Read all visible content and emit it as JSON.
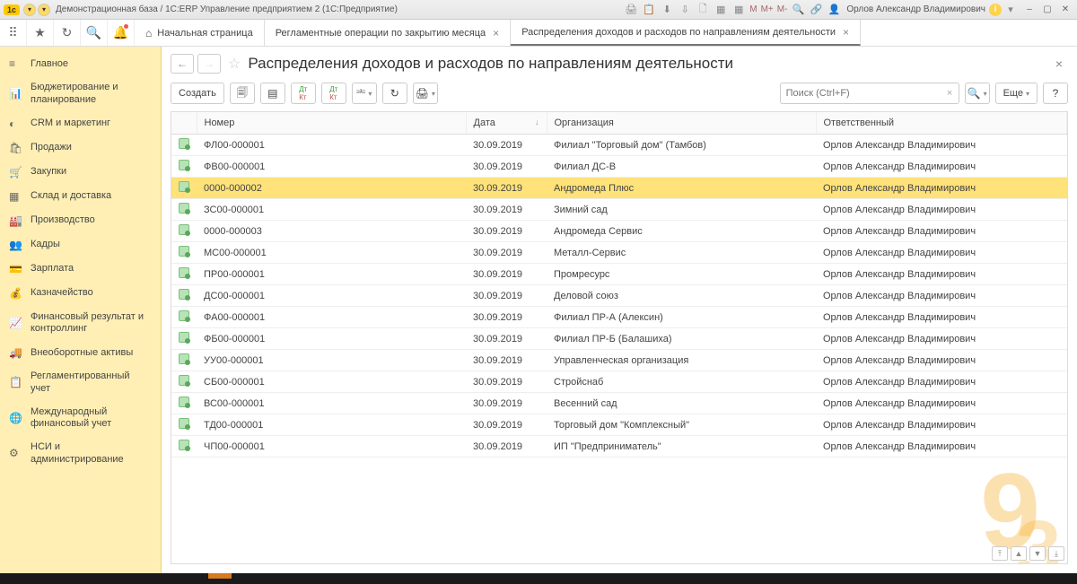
{
  "titlebar": {
    "logo": "1c",
    "title": "Демонстрационная база / 1С:ERP Управление предприятием 2  (1С:Предприятие)",
    "m1": "M",
    "m2": "M+",
    "m3": "M-",
    "user": "Орлов Александр Владимирович"
  },
  "tabs": {
    "home_label": "Начальная страница",
    "tab1": "Регламентные операции по закрытию месяца",
    "tab2": "Распределения доходов и расходов по направлениям деятельности"
  },
  "sidebar": {
    "items": [
      {
        "icon": "≡",
        "label": "Главное"
      },
      {
        "icon": "📊",
        "label": "Бюджетирование и планирование"
      },
      {
        "icon": "◐",
        "label": "CRM и маркетинг"
      },
      {
        "icon": "🛍",
        "label": "Продажи"
      },
      {
        "icon": "🛒",
        "label": "Закупки"
      },
      {
        "icon": "▦",
        "label": "Склад и доставка"
      },
      {
        "icon": "🏭",
        "label": "Производство"
      },
      {
        "icon": "👥",
        "label": "Кадры"
      },
      {
        "icon": "💳",
        "label": "Зарплата"
      },
      {
        "icon": "💰",
        "label": "Казначейство"
      },
      {
        "icon": "📈",
        "label": "Финансовый результат и контроллинг"
      },
      {
        "icon": "🚚",
        "label": "Внеоборотные активы"
      },
      {
        "icon": "📋",
        "label": "Регламентированный учет"
      },
      {
        "icon": "🌐",
        "label": "Международный финансовый учет"
      },
      {
        "icon": "⚙",
        "label": "НСИ и администрирование"
      }
    ]
  },
  "page": {
    "title": "Распределения доходов и расходов по направлениям деятельности",
    "create_label": "Создать",
    "more_label": "Еще",
    "search_placeholder": "Поиск (Ctrl+F)"
  },
  "table": {
    "cols": {
      "num": "Номер",
      "date": "Дата",
      "org": "Организация",
      "resp": "Ответственный"
    },
    "rows": [
      {
        "num": "ФЛ00-000001",
        "date": "30.09.2019",
        "org": "Филиал \"Торговый дом\" (Тамбов)",
        "resp": "Орлов Александр Владимирович",
        "sel": false
      },
      {
        "num": "ФВ00-000001",
        "date": "30.09.2019",
        "org": "Филиал ДС-В",
        "resp": "Орлов Александр Владимирович",
        "sel": false
      },
      {
        "num": "0000-000002",
        "date": "30.09.2019",
        "org": "Андромеда Плюс",
        "resp": "Орлов Александр Владимирович",
        "sel": true
      },
      {
        "num": "ЗС00-000001",
        "date": "30.09.2019",
        "org": "Зимний сад",
        "resp": "Орлов Александр Владимирович",
        "sel": false
      },
      {
        "num": "0000-000003",
        "date": "30.09.2019",
        "org": "Андромеда Сервис",
        "resp": "Орлов Александр Владимирович",
        "sel": false
      },
      {
        "num": "МС00-000001",
        "date": "30.09.2019",
        "org": "Металл-Сервис",
        "resp": "Орлов Александр Владимирович",
        "sel": false
      },
      {
        "num": "ПР00-000001",
        "date": "30.09.2019",
        "org": "Промресурс",
        "resp": "Орлов Александр Владимирович",
        "sel": false
      },
      {
        "num": "ДС00-000001",
        "date": "30.09.2019",
        "org": "Деловой союз",
        "resp": "Орлов Александр Владимирович",
        "sel": false
      },
      {
        "num": "ФА00-000001",
        "date": "30.09.2019",
        "org": "Филиал ПР-А (Алексин)",
        "resp": "Орлов Александр Владимирович",
        "sel": false
      },
      {
        "num": "ФБ00-000001",
        "date": "30.09.2019",
        "org": "Филиал ПР-Б (Балашиха)",
        "resp": "Орлов Александр Владимирович",
        "sel": false
      },
      {
        "num": "УУ00-000001",
        "date": "30.09.2019",
        "org": "Управленческая организация",
        "resp": "Орлов Александр Владимирович",
        "sel": false
      },
      {
        "num": "СБ00-000001",
        "date": "30.09.2019",
        "org": "Стройснаб",
        "resp": "Орлов Александр Владимирович",
        "sel": false
      },
      {
        "num": "ВС00-000001",
        "date": "30.09.2019",
        "org": "Весенний сад",
        "resp": "Орлов Александр Владимирович",
        "sel": false
      },
      {
        "num": "ТД00-000001",
        "date": "30.09.2019",
        "org": "Торговый дом \"Комплексный\"",
        "resp": "Орлов Александр Владимирович",
        "sel": false
      },
      {
        "num": "ЧП00-000001",
        "date": "30.09.2019",
        "org": "ИП \"Предприниматель\"",
        "resp": "Орлов Александр Владимирович",
        "sel": false
      }
    ]
  }
}
